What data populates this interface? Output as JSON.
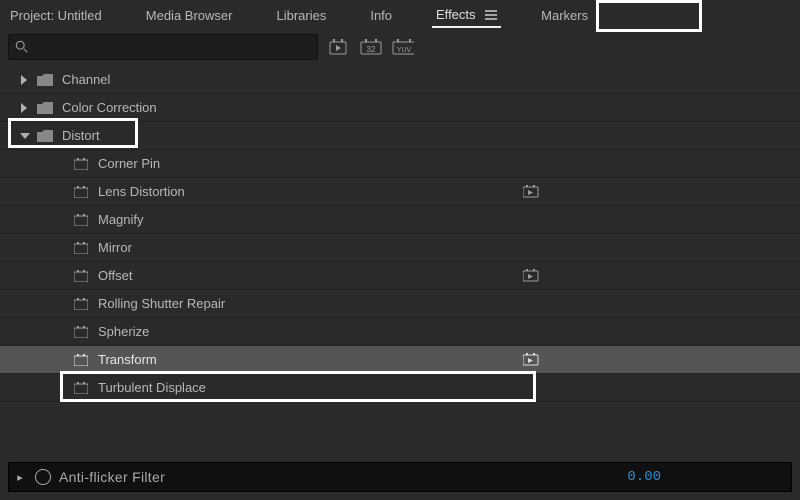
{
  "tabs": {
    "project": "Project: Untitled",
    "media": "Media Browser",
    "libraries": "Libraries",
    "info": "Info",
    "effects": "Effects",
    "markers": "Markers"
  },
  "search": {
    "placeholder": ""
  },
  "toolbar_icons": {
    "a": "accel-icon",
    "b": "32-bit-icon",
    "b_text": "32",
    "c": "yuv-icon",
    "c_text": "YUV"
  },
  "tree": {
    "channel": "Channel",
    "color_correction": "Color Correction",
    "distort": "Distort",
    "items": {
      "corner_pin": "Corner Pin",
      "lens_distortion": "Lens Distortion",
      "magnify": "Magnify",
      "mirror": "Mirror",
      "offset": "Offset",
      "rolling_shutter": "Rolling Shutter Repair",
      "spherize": "Spherize",
      "transform": "Transform",
      "turbulent": "Turbulent Displace"
    }
  },
  "bottom": {
    "label": "Anti-flicker Filter",
    "value": "0.00"
  }
}
